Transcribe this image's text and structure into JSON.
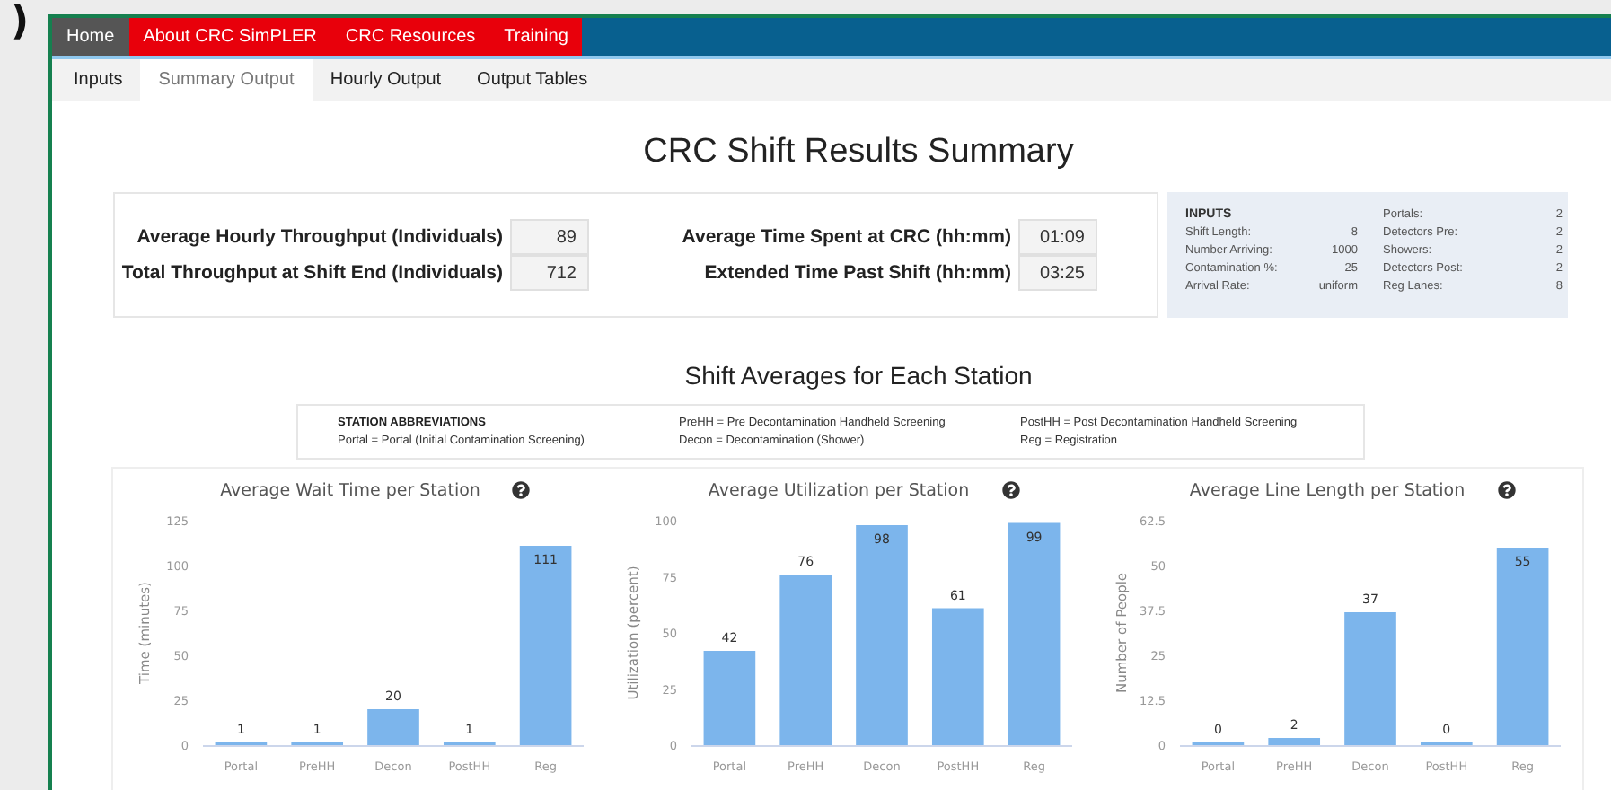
{
  "figure_label": ")",
  "nav": [
    {
      "label": "Home",
      "kind": "home"
    },
    {
      "label": "About CRC SimPLER",
      "kind": "highlight"
    },
    {
      "label": "CRC Resources",
      "kind": "highlight"
    },
    {
      "label": "Training",
      "kind": "highlight"
    }
  ],
  "tabs": [
    {
      "label": "Inputs",
      "selected": false
    },
    {
      "label": "Summary Output",
      "selected": true
    },
    {
      "label": "Hourly Output",
      "selected": false
    },
    {
      "label": "Output Tables",
      "selected": false
    }
  ],
  "title": "CRC Shift Results Summary",
  "metrics": [
    {
      "label": "Average Hourly Throughput (Individuals)",
      "value": "89"
    },
    {
      "label": "Average Time Spent at CRC (hh:mm)",
      "value": "01:09"
    },
    {
      "label": "Total Throughput at Shift End (Individuals)",
      "value": "712"
    },
    {
      "label": "Extended Time Past Shift (hh:mm)",
      "value": "03:25"
    }
  ],
  "inputs": {
    "title": "INPUTS",
    "columns": [
      [
        {
          "label": "Shift Length:",
          "value": "8"
        },
        {
          "label": "Number Arriving:",
          "value": "1000"
        },
        {
          "label": "Contamination %:",
          "value": "25"
        },
        {
          "label": "Arrival Rate:",
          "value": "uniform"
        }
      ],
      [
        {
          "label": "Portals:",
          "value": "2"
        },
        {
          "label": "Detectors Pre:",
          "value": "2"
        },
        {
          "label": "Showers:",
          "value": "2"
        },
        {
          "label": "Detectors Post:",
          "value": "2"
        },
        {
          "label": "Reg Lanes:",
          "value": "8"
        }
      ]
    ]
  },
  "section_title": "Shift Averages for Each Station",
  "abbreviations": {
    "title": "STATION ABBREVIATIONS",
    "items": [
      "Portal = Portal (Initial Contamination Screening)",
      "PreHH = Pre Decontamination Handheld Screening",
      "Decon = Decontamination (Shower)",
      "PostHH = Post Decontamination Handheld Screening",
      "Reg = Registration"
    ]
  },
  "charts": [
    {
      "chart_data": {
        "type": "bar",
        "title": "Average Wait Time per Station",
        "ylabel": "Time (minutes)",
        "categories": [
          "Portal",
          "PreHH",
          "Decon",
          "PostHH",
          "Reg"
        ],
        "series": [
          {
            "color": "#7cb5ec",
            "values": [
              1,
              1,
              20,
              1,
              111
            ]
          }
        ],
        "ylim": [
          0,
          125
        ],
        "yticks": [
          0,
          25,
          50,
          75,
          100,
          125
        ],
        "data_labels": true
      }
    },
    {
      "chart_data": {
        "type": "bar",
        "title": "Average Utilization per Station",
        "ylabel": "Utilization (percent)",
        "categories": [
          "Portal",
          "PreHH",
          "Decon",
          "PostHH",
          "Reg"
        ],
        "series": [
          {
            "color": "#7cb5ec",
            "values": [
              42,
              76,
              98,
              61,
              99
            ]
          }
        ],
        "ylim": [
          0,
          100
        ],
        "yticks": [
          0,
          25,
          50,
          75,
          100
        ],
        "data_labels": true
      }
    },
    {
      "chart_data": {
        "type": "bar",
        "title": "Average Line Length per Station",
        "ylabel": "Number of People",
        "categories": [
          "Portal",
          "PreHH",
          "Decon",
          "PostHH",
          "Reg"
        ],
        "series": [
          {
            "color": "#7cb5ec",
            "values": [
              0,
              2,
              37,
              0,
              55
            ]
          }
        ],
        "ylim": [
          0,
          62.5
        ],
        "yticks": [
          0,
          12.5,
          25,
          37.5,
          50,
          62.5
        ],
        "data_labels": true
      }
    }
  ]
}
